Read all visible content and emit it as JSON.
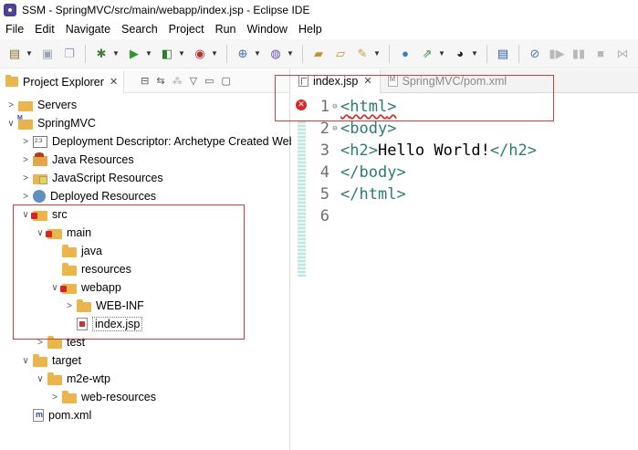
{
  "window": {
    "title": "SSM - SpringMVC/src/main/webapp/index.jsp - Eclipse IDE"
  },
  "menu": [
    "File",
    "Edit",
    "Navigate",
    "Search",
    "Project",
    "Run",
    "Window",
    "Help"
  ],
  "toolbar": {
    "icons": [
      "new-icon",
      "save-icon",
      "save-all-icon",
      "debug-icon",
      "run-icon",
      "coverage-icon",
      "external-tools-icon",
      "new-server-icon",
      "new-class-icon",
      "open-type-icon",
      "open-task-icon",
      "search-icon",
      "web-browser-icon",
      "navigate-icon",
      "view-menu-icon",
      "console-icon",
      "skip-breakpoints-icon",
      "resume-icon",
      "suspend-icon",
      "terminate-icon",
      "disconnect-icon"
    ]
  },
  "explorer": {
    "tab_label": "Project Explorer",
    "tree": [
      {
        "label": "Servers",
        "depth": 0,
        "arrow": "collapsed",
        "icon": "folder-icon"
      },
      {
        "label": "SpringMVC",
        "depth": 0,
        "arrow": "expanded",
        "icon": "maven-project-icon"
      },
      {
        "label": "Deployment Descriptor: Archetype Created Web Application",
        "depth": 1,
        "arrow": "collapsed",
        "icon": "deployment-descriptor-icon"
      },
      {
        "label": "Java Resources",
        "depth": 1,
        "arrow": "collapsed",
        "icon": "java-resources-icon"
      },
      {
        "label": "JavaScript Resources",
        "depth": 1,
        "arrow": "collapsed",
        "icon": "javascript-resources-icon"
      },
      {
        "label": "Deployed Resources",
        "depth": 1,
        "arrow": "collapsed",
        "icon": "deployed-resources-icon"
      },
      {
        "label": "src",
        "depth": 1,
        "arrow": "expanded",
        "icon": "error-folder-icon"
      },
      {
        "label": "main",
        "depth": 2,
        "arrow": "expanded",
        "icon": "error-folder-icon"
      },
      {
        "label": "java",
        "depth": 3,
        "arrow": "none",
        "icon": "folder-icon"
      },
      {
        "label": "resources",
        "depth": 3,
        "arrow": "none",
        "icon": "folder-icon"
      },
      {
        "label": "webapp",
        "depth": 3,
        "arrow": "expanded",
        "icon": "error-folder-icon"
      },
      {
        "label": "WEB-INF",
        "depth": 4,
        "arrow": "collapsed",
        "icon": "folder-icon"
      },
      {
        "label": "index.jsp",
        "depth": 4,
        "arrow": "none",
        "icon": "jsp-file-error-icon"
      },
      {
        "label": "test",
        "depth": 2,
        "arrow": "collapsed",
        "icon": "folder-icon"
      },
      {
        "label": "target",
        "depth": 1,
        "arrow": "expanded",
        "icon": "folder-icon"
      },
      {
        "label": "m2e-wtp",
        "depth": 2,
        "arrow": "expanded",
        "icon": "folder-icon"
      },
      {
        "label": "web-resources",
        "depth": 3,
        "arrow": "collapsed",
        "icon": "folder-icon"
      },
      {
        "label": "pom.xml",
        "depth": 1,
        "arrow": "none",
        "icon": "pom-file-icon"
      }
    ]
  },
  "editor": {
    "tabs": [
      {
        "label": "index.jsp",
        "active": true
      },
      {
        "label": "SpringMVC/pom.xml",
        "active": false
      }
    ],
    "lines": [
      {
        "num": "1",
        "fold": "⊖",
        "open": "<",
        "name": "html",
        "close": ">",
        "text": "",
        "end": ""
      },
      {
        "num": "2",
        "fold": "⊖",
        "open": "<",
        "name": "body",
        "close": ">",
        "text": "",
        "end": ""
      },
      {
        "num": "3",
        "fold": "",
        "open": "<",
        "name": "h2",
        "close": ">",
        "text": "Hello World!",
        "end": "</h2>"
      },
      {
        "num": "4",
        "fold": "",
        "open": "</",
        "name": "body",
        "close": ">",
        "text": "",
        "end": ""
      },
      {
        "num": "5",
        "fold": "",
        "open": "</",
        "name": "html",
        "close": ">",
        "text": "",
        "end": ""
      },
      {
        "num": "6",
        "fold": "",
        "open": "",
        "name": "",
        "close": "",
        "text": "",
        "end": ""
      }
    ],
    "error_line": "1"
  },
  "colors": {
    "annotation_box": "#d93a3a",
    "tag": "#2d7b70",
    "error": "#d42a2a"
  }
}
